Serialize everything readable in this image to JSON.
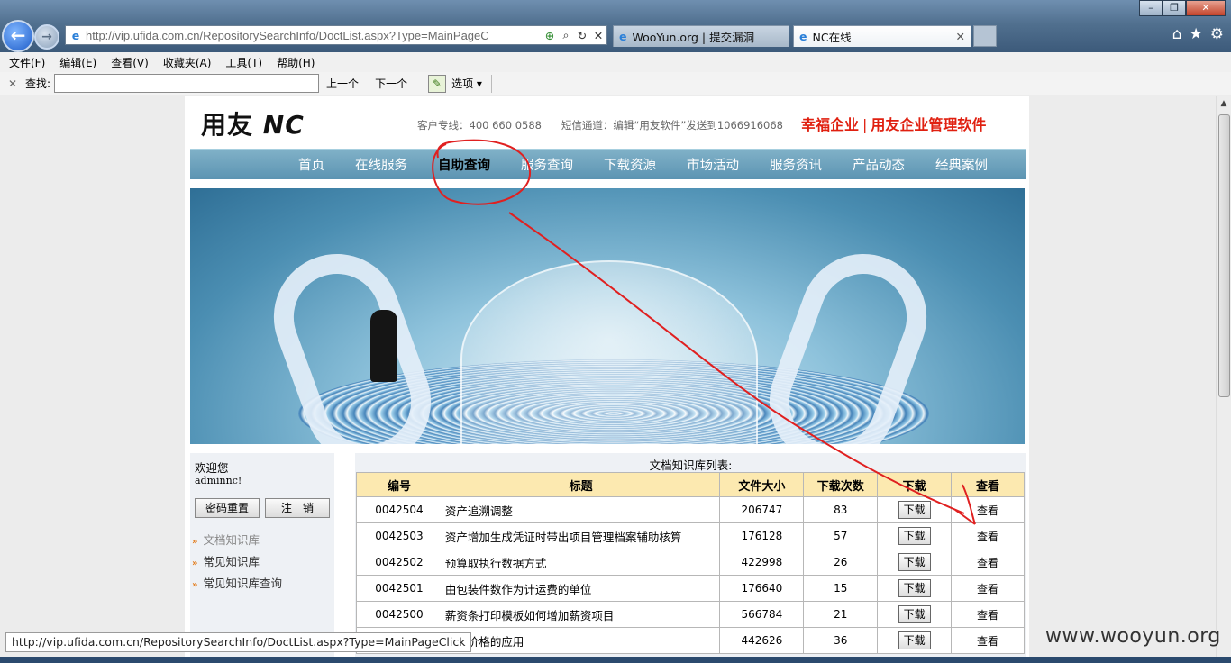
{
  "browser": {
    "url": "http://vip.ufida.com.cn/RepositorySearchInfo/DoctList.aspx?Type=MainPageC",
    "tabs": [
      {
        "label": "WooYun.org | 提交漏洞"
      },
      {
        "label": "NC在线"
      }
    ],
    "menu": [
      "文件(F)",
      "编辑(E)",
      "查看(V)",
      "收藏夹(A)",
      "工具(T)",
      "帮助(H)"
    ],
    "find": {
      "label": "查找:",
      "value": "",
      "prev": "上一个",
      "next": "下一个",
      "options": "选项"
    }
  },
  "site": {
    "logo_text": "用友",
    "logo_nc": "NC",
    "contact": "客户专线：400 660 0588      短信通道：编辑“用友软件”发送到1066916068",
    "slogan_left": "幸福企业",
    "slogan_right": "用友企业管理软件",
    "nav": [
      "首页",
      "在线服务",
      "自助查询",
      "服务查询",
      "下载资源",
      "市场活动",
      "服务资讯",
      "产品动态",
      "经典案例"
    ],
    "nav_active_index": 2
  },
  "sidebar": {
    "welcome": "欢迎您",
    "user": "adminnc!",
    "reset_btn": "密码重置",
    "logout_btn": "注　销",
    "links": [
      "文档知识库",
      "常见知识库",
      "常见知识库查询"
    ]
  },
  "docs": {
    "title": "文档知识库列表:",
    "headers": [
      "编号",
      "标题",
      "文件大小",
      "下载次数",
      "下载",
      "查看"
    ],
    "download_label": "下载",
    "view_label": "查看",
    "rows": [
      {
        "id": "0042504",
        "title": "资产追溯调整",
        "size": "206747",
        "count": "83"
      },
      {
        "id": "0042503",
        "title": "资产增加生成凭证时带出项目管理档案辅助核算",
        "size": "176128",
        "count": "57"
      },
      {
        "id": "0042502",
        "title": "预算取执行数据方式",
        "size": "422998",
        "count": "26"
      },
      {
        "id": "0042501",
        "title": "由包装件数作为计运费的单位",
        "size": "176640",
        "count": "15"
      },
      {
        "id": "0042500",
        "title": "薪资条打印模板如何增加薪资项目",
        "size": "566784",
        "count": "21"
      },
      {
        "id": "",
        "title": "销售价格的应用",
        "size": "442626",
        "count": "36"
      }
    ]
  },
  "status_url": "http://vip.ufida.com.cn/RepositorySearchInfo/DoctList.aspx?Type=MainPageClick",
  "watermark": "www.wooyun.org",
  "colors": {
    "nav": "#5c94b2",
    "header_row": "#fce9b0",
    "slogan": "#e02010",
    "annotation": "#e02020"
  }
}
